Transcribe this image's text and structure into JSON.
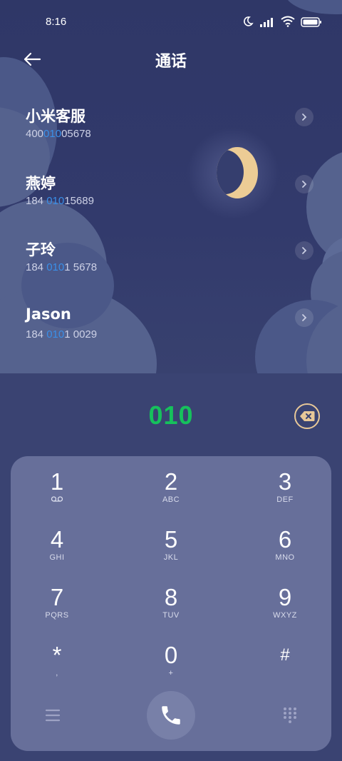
{
  "status_bar": {
    "time": "8:16",
    "icons": [
      "moon-icon",
      "signal-icon",
      "wifi-icon",
      "battery-icon"
    ]
  },
  "header": {
    "title": "通话",
    "back_icon": "arrow-left-icon"
  },
  "contacts": [
    {
      "name": "小米客服",
      "number_pre": "400",
      "number_match": "010",
      "number_post": "05678"
    },
    {
      "name": "燕婷",
      "number_pre": "184 ",
      "number_match": "010",
      "number_post": "15689"
    },
    {
      "name": "子玲",
      "number_pre": "184 ",
      "number_match": "010",
      "number_post": "1 5678"
    },
    {
      "name": "Jason",
      "number_pre": "184 ",
      "number_match": "010",
      "number_post": "1 0029"
    }
  ],
  "dialer": {
    "input_value": "010",
    "delete_icon": "backspace-icon"
  },
  "keypad": {
    "keys": [
      {
        "num": "1",
        "sub": ""
      },
      {
        "num": "2",
        "sub": "ABC"
      },
      {
        "num": "3",
        "sub": "DEF"
      },
      {
        "num": "4",
        "sub": "GHI"
      },
      {
        "num": "5",
        "sub": "JKL"
      },
      {
        "num": "6",
        "sub": "MNO"
      },
      {
        "num": "7",
        "sub": "PQRS"
      },
      {
        "num": "8",
        "sub": "TUV"
      },
      {
        "num": "9",
        "sub": "WXYZ"
      },
      {
        "num": "*",
        "sub": ","
      },
      {
        "num": "0",
        "sub": "+"
      },
      {
        "num": "#",
        "sub": ""
      }
    ]
  },
  "colors": {
    "accent_green": "#16c15c",
    "highlight_blue": "#3a8fe8",
    "moon": "#eccc95",
    "pad_bg": "#676f9a",
    "page_bg": "#3a4372"
  }
}
